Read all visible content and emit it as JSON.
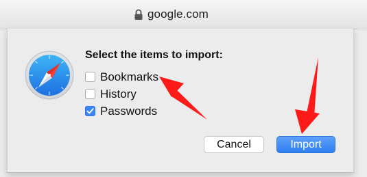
{
  "addressbar": {
    "url": "google.com",
    "lock_icon": "lock-icon"
  },
  "dialog": {
    "app_icon": "safari-compass-icon",
    "prompt": "Select the items to import:",
    "options": [
      {
        "label": "Bookmarks",
        "checked": false
      },
      {
        "label": "History",
        "checked": false
      },
      {
        "label": "Passwords",
        "checked": true
      }
    ],
    "cancel_label": "Cancel",
    "import_label": "Import"
  },
  "annotations": {
    "arrow_color": "#ff1a1a"
  },
  "colors": {
    "accent": "#3b86f5"
  }
}
